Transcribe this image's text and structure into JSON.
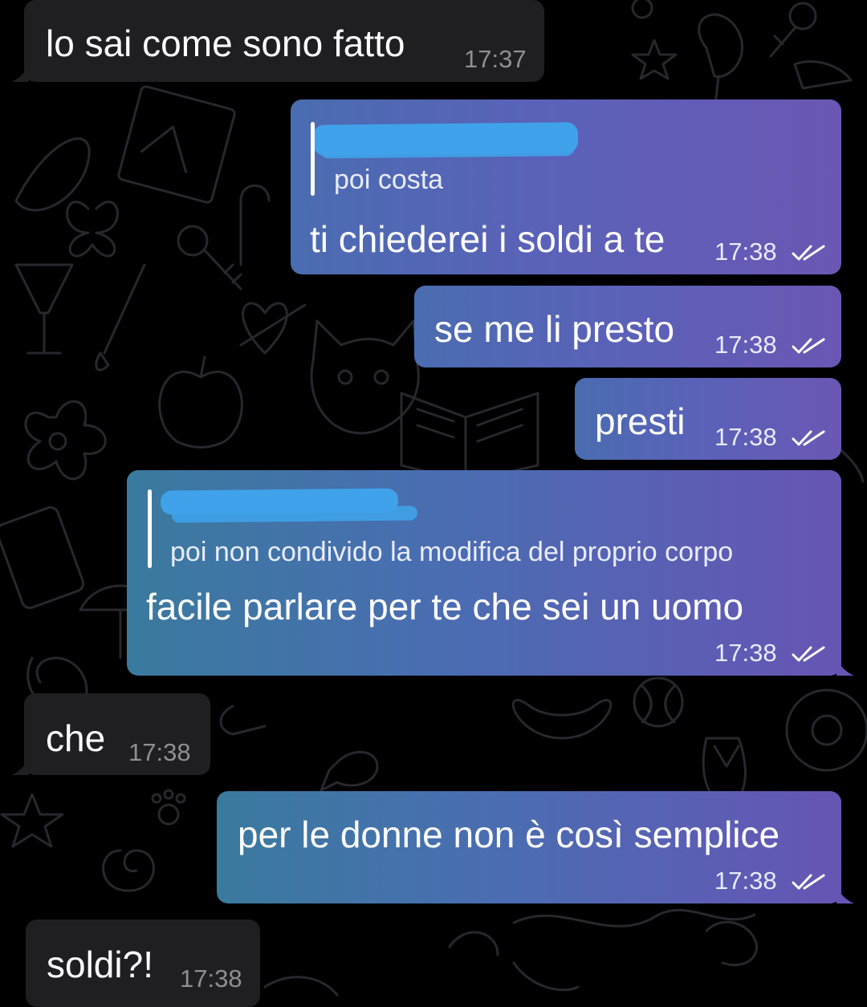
{
  "background": {
    "base_color": "#000000",
    "doodle_color": "#2b2b30",
    "pattern": "doodle-wallpaper"
  },
  "colors": {
    "incoming_bubble": "#1f1f22",
    "outgoing_bubble_start": "#4a6cb0",
    "outgoing_bubble_end": "#6a57b4",
    "incoming_time": "#8e8e93",
    "redaction": "#3fa2ea"
  },
  "messages": [
    {
      "direction": "in",
      "text": "lo sai come sono fatto",
      "time": "17:37"
    },
    {
      "direction": "out",
      "reply_quote": "poi costa",
      "reply_sender_redacted": true,
      "text": "ti chiederei i soldi a te",
      "time": "17:38",
      "status_icon": "double-check-icon"
    },
    {
      "direction": "out",
      "text": "se me li presto",
      "time": "17:38",
      "status_icon": "double-check-icon"
    },
    {
      "direction": "out",
      "text": "presti",
      "time": "17:38",
      "status_icon": "double-check-icon"
    },
    {
      "direction": "out",
      "reply_quote": "poi non condivido la modifica del proprio corpo",
      "reply_sender_redacted": true,
      "text": "facile parlare per te che sei un uomo",
      "time": "17:38",
      "status_icon": "double-check-icon"
    },
    {
      "direction": "in",
      "text": "che",
      "time": "17:38"
    },
    {
      "direction": "out",
      "text": "per le donne non è così semplice",
      "time": "17:38",
      "status_icon": "double-check-icon"
    },
    {
      "direction": "in",
      "text": "soldi?!",
      "time": "17:38"
    }
  ]
}
